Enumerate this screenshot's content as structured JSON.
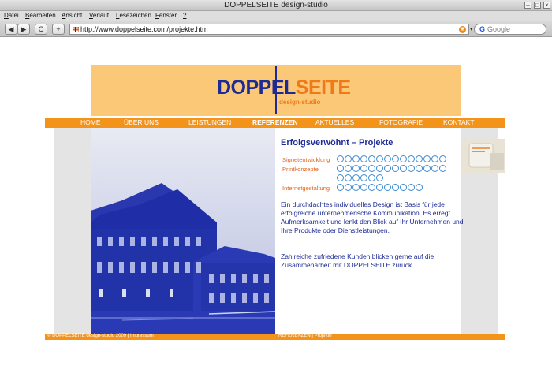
{
  "browser": {
    "title": "DOPPELSEITE design-studio",
    "menu": [
      "Datei",
      "Bearbeiten",
      "Ansicht",
      "Verlauf",
      "Lesezeichen",
      "Fenster",
      "?"
    ],
    "menu_underlines": [
      "D",
      "B",
      "A",
      "V",
      "L",
      "F",
      "?"
    ],
    "toolbar": {
      "back": "◀",
      "forward": "▶",
      "reload": "C",
      "add": "+"
    },
    "url": "http://www.doppelseite.com/projekte.htm",
    "search_placeholder": "Google",
    "search_icon": "google-g-icon"
  },
  "site": {
    "logo_main_a": "DOPPEL",
    "logo_main_b": "SEITE",
    "logo_sub": "design-studio",
    "nav": [
      {
        "label": "HOME",
        "active": false
      },
      {
        "label": "ÜBER UNS",
        "active": false
      },
      {
        "label": "LEISTUNGEN",
        "active": false
      },
      {
        "label": "REFERENZEN",
        "active": true
      },
      {
        "label": "AKTUELLES",
        "active": false
      },
      {
        "label": "FOTOGRAFIE",
        "active": false
      },
      {
        "label": "KONTAKT",
        "active": false
      }
    ],
    "content_title": "Erfolgsverwöhnt – Projekte",
    "references": [
      {
        "label": "Signetentwicklung",
        "count": 14
      },
      {
        "label": "Printkonzepte",
        "count": 20
      },
      {
        "label": "Internetgestaltung",
        "count": 11
      }
    ],
    "paragraph_1": "Ein durchdachtes individuelles Design ist Basis für jede erfolgreiche unternehmerische Kommunikation. Es erregt Aufmerksamkeit und lenkt den Blick auf Ihr Unternehmen und Ihre Produkte oder Dienstleistungen.",
    "paragraph_2": "Zahlreiche zufriedene Kunden blicken gerne auf die Zusammenarbeit mit DOPPELSEITE zurück.",
    "footer_left": "© DOPPELSEITE design-studio 2009 | Impressum",
    "footer_right": "REFERENZEN | Projekte",
    "colors": {
      "orange": "#f3931a",
      "navy": "#1d2b96",
      "peach": "#fbc878",
      "circle": "#3d8ad2"
    }
  }
}
